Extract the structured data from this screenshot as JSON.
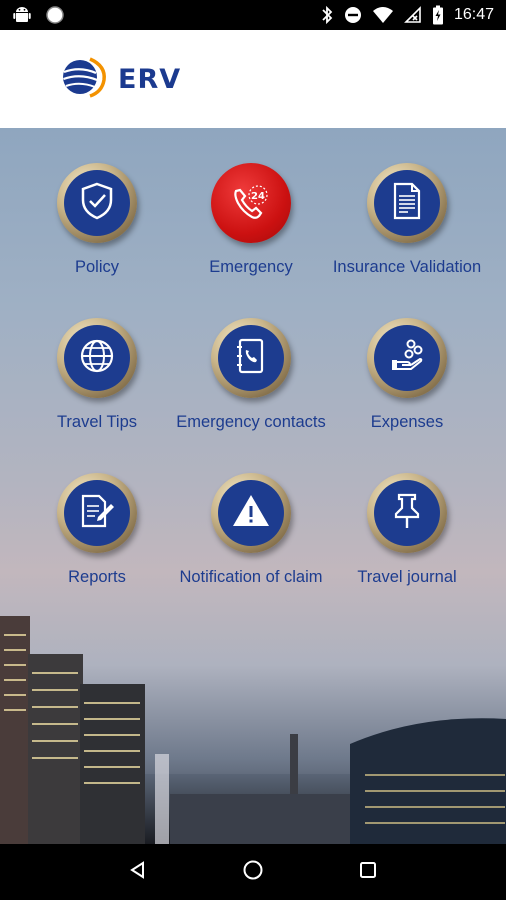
{
  "status_bar": {
    "time": "16:47",
    "left_icons": [
      "android-icon",
      "circle-notification-icon"
    ],
    "right_icons": [
      "bluetooth-icon",
      "do-not-disturb-icon",
      "wifi-icon",
      "no-signal-icon",
      "battery-charging-icon"
    ]
  },
  "header": {
    "logo_text": "ERV",
    "logo_icon": "erv-globe-logo-icon",
    "colors": {
      "brand_blue": "#1b3a8f",
      "brand_orange": "#f39200"
    }
  },
  "tiles": [
    {
      "label": "Policy",
      "icon": "shield-check-icon"
    },
    {
      "label": "Emergency",
      "icon": "phone-24-icon"
    },
    {
      "label": "Insurance Validation",
      "icon": "document-icon"
    },
    {
      "label": "Travel Tips",
      "icon": "globe-icon"
    },
    {
      "label": "Emergency contacts",
      "icon": "address-book-icon"
    },
    {
      "label": "Expenses",
      "icon": "hand-coins-icon"
    },
    {
      "label": "Reports",
      "icon": "report-edit-icon"
    },
    {
      "label": "Notification of claim",
      "icon": "warning-triangle-icon"
    },
    {
      "label": "Travel journal",
      "icon": "pushpin-icon"
    }
  ],
  "nav_bar": {
    "buttons": [
      "back-icon",
      "home-icon",
      "recents-icon"
    ]
  }
}
